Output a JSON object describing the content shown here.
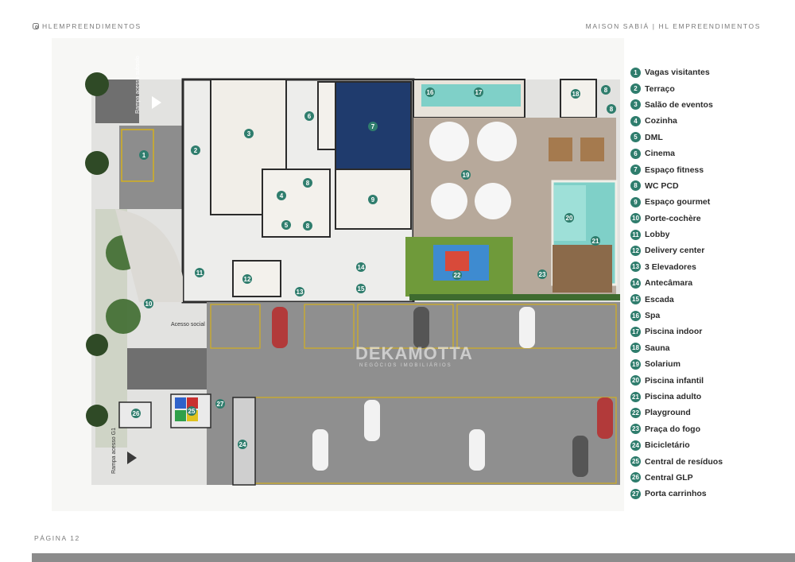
{
  "header": {
    "instagram_handle": "HLEMPREENDIMENTOS",
    "project_title": "MAISON SABIÁ | HL EMPREENDIMENTOS"
  },
  "plan": {
    "labels": {
      "ramp_top": "Rampa acesso subsolo",
      "ramp_bottom": "Rampa acesso G1",
      "social_access": "Acesso social"
    },
    "watermark": "DEKAMOTTA",
    "watermark_sub": "NEGÓCIOS IMOBILIÁRIOS"
  },
  "legend": [
    {
      "num": "1",
      "label": "Vagas visitantes"
    },
    {
      "num": "2",
      "label": "Terraço"
    },
    {
      "num": "3",
      "label": "Salão de eventos"
    },
    {
      "num": "4",
      "label": "Cozinha"
    },
    {
      "num": "5",
      "label": "DML"
    },
    {
      "num": "6",
      "label": "Cinema"
    },
    {
      "num": "7",
      "label": "Espaço fitness"
    },
    {
      "num": "8",
      "label": "WC PCD"
    },
    {
      "num": "9",
      "label": "Espaço gourmet"
    },
    {
      "num": "10",
      "label": "Porte-cochère"
    },
    {
      "num": "11",
      "label": "Lobby"
    },
    {
      "num": "12",
      "label": "Delivery center"
    },
    {
      "num": "13",
      "label": "3 Elevadores"
    },
    {
      "num": "14",
      "label": "Antecâmara"
    },
    {
      "num": "15",
      "label": "Escada"
    },
    {
      "num": "16",
      "label": "Spa"
    },
    {
      "num": "17",
      "label": "Piscina indoor"
    },
    {
      "num": "18",
      "label": "Sauna"
    },
    {
      "num": "19",
      "label": "Solarium"
    },
    {
      "num": "20",
      "label": "Piscina infantil"
    },
    {
      "num": "21",
      "label": "Piscina adulto"
    },
    {
      "num": "22",
      "label": "Playground"
    },
    {
      "num": "23",
      "label": "Praça do fogo"
    },
    {
      "num": "24",
      "label": "Bicicletário"
    },
    {
      "num": "25",
      "label": "Central de resíduos"
    },
    {
      "num": "26",
      "label": "Central GLP"
    },
    {
      "num": "27",
      "label": "Porta carrinhos"
    }
  ],
  "footer": {
    "page_label": "PÁGINA 12"
  },
  "colors": {
    "badge": "#2f7d6d",
    "parking_lines": "#d4b01e",
    "pool": "#7fd0c8",
    "paving": "#8f8f8f",
    "deck": "#b7a99b"
  }
}
